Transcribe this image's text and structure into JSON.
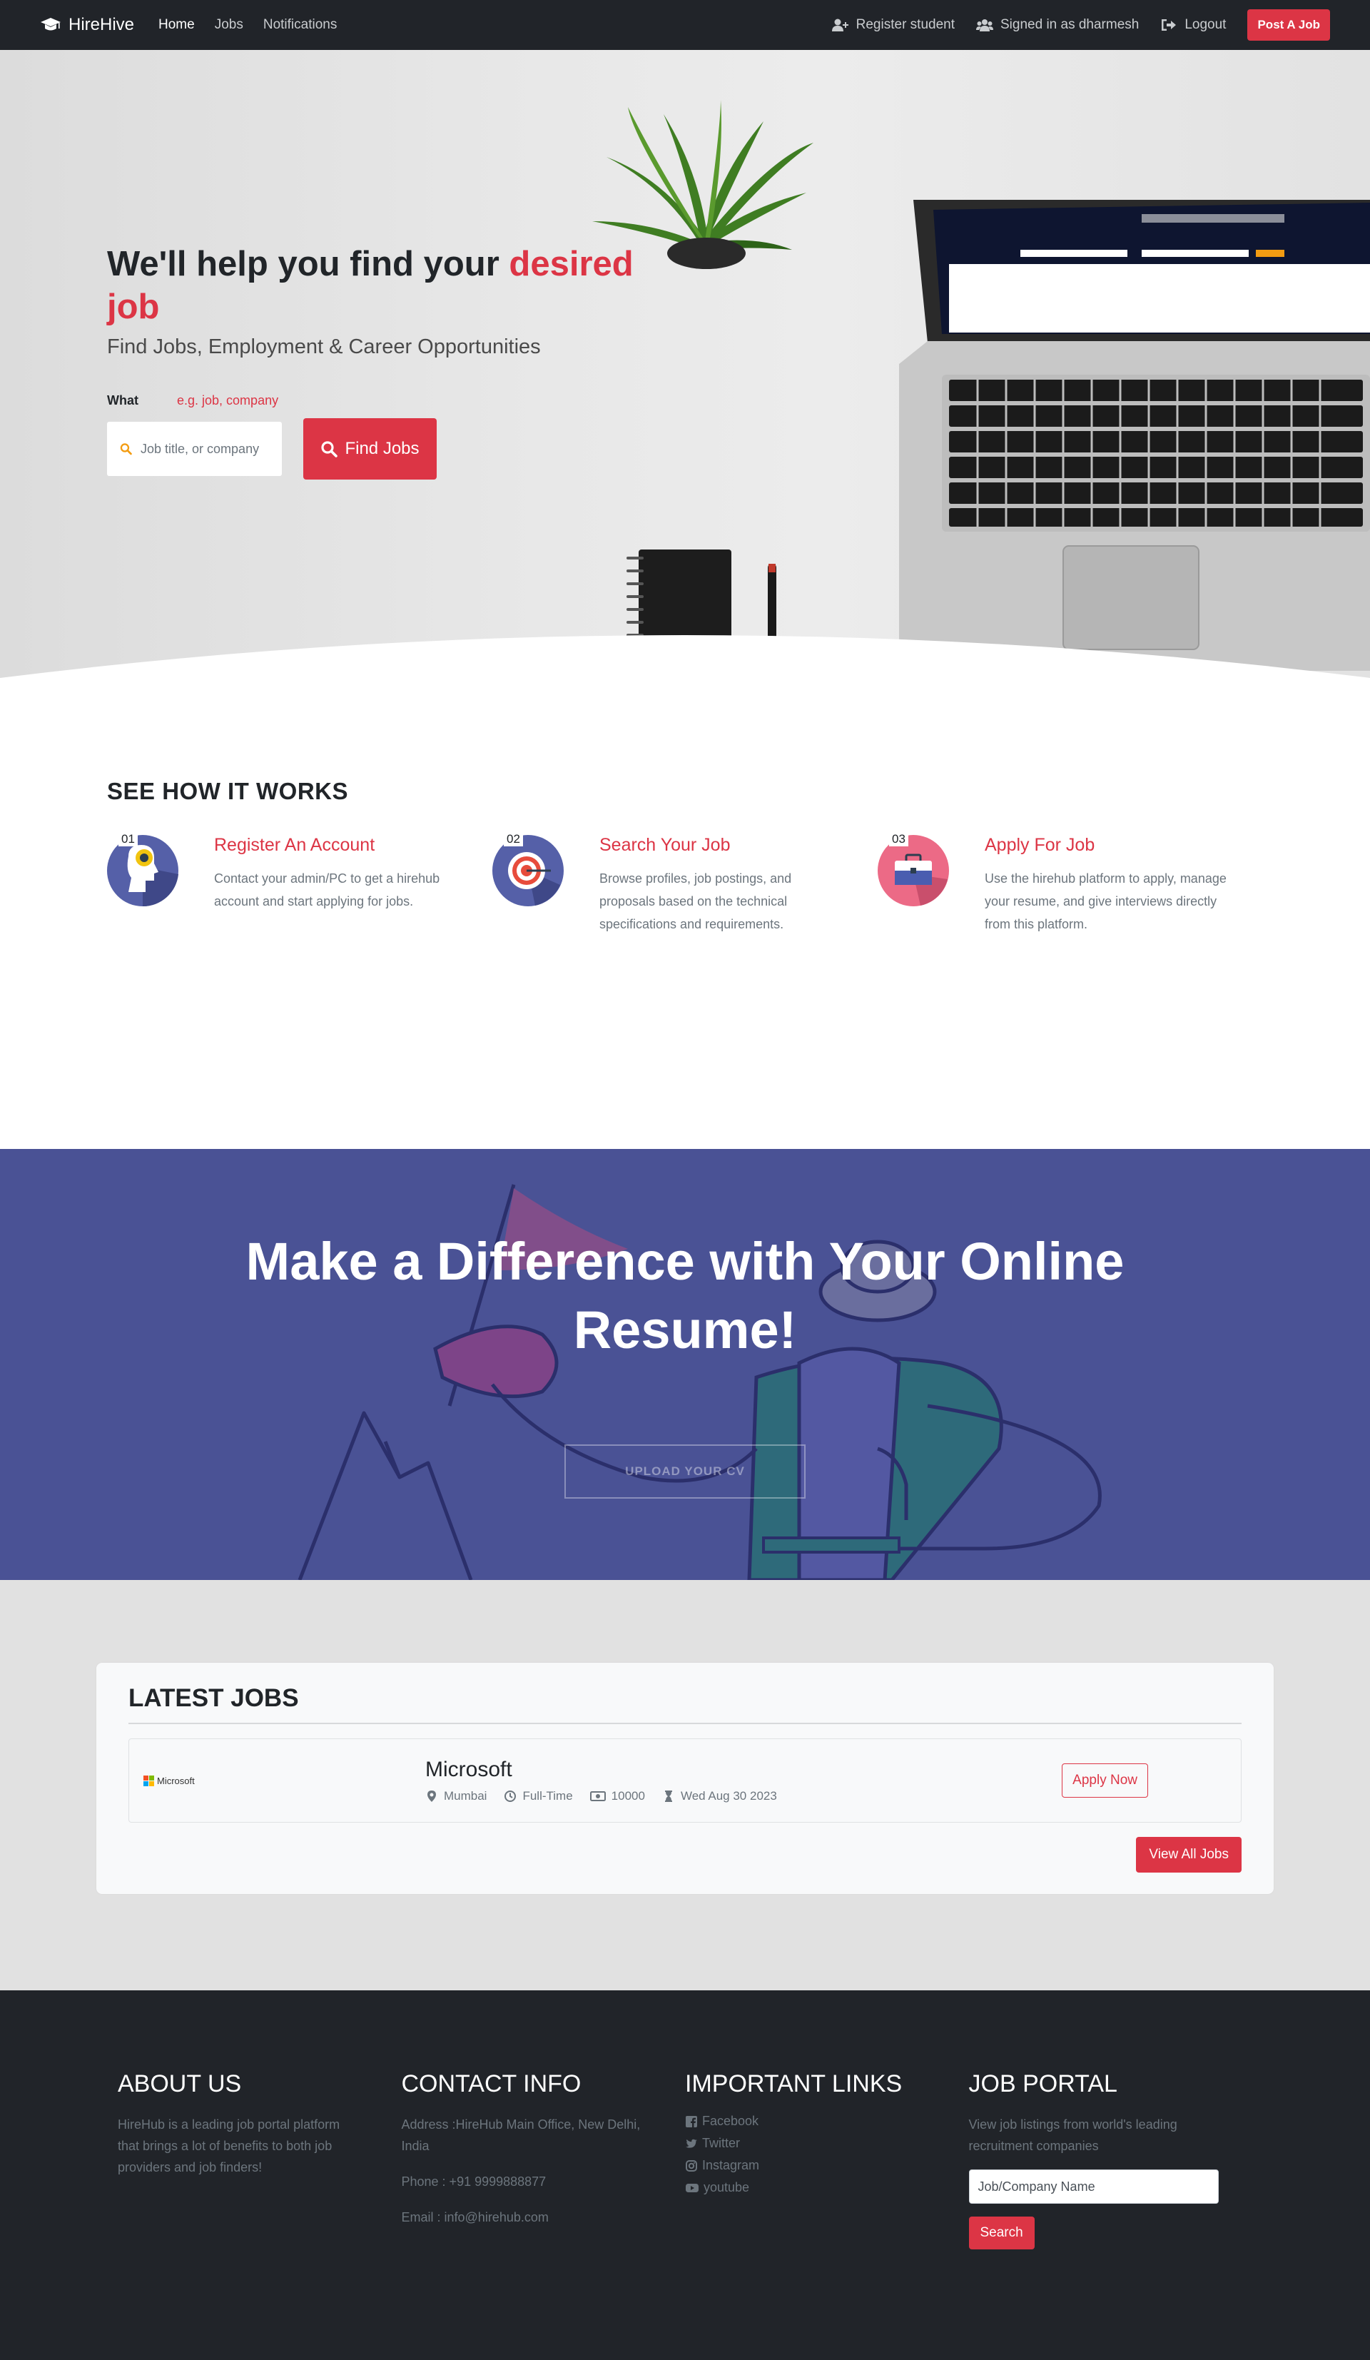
{
  "nav": {
    "brand": "HireHive",
    "links": [
      "Home",
      "Jobs",
      "Notifications"
    ],
    "register": "Register student",
    "signed_in": "Signed in as dharmesh",
    "logout": "Logout",
    "post_job": "Post A Job"
  },
  "hero": {
    "title_part1": "We'll help you find your ",
    "title_accent1": "desired",
    "title_accent2": "job",
    "subtitle": "Find Jobs, Employment & Career Opportunities",
    "what_label": "What",
    "what_hint": "e.g. job, company",
    "search_placeholder": "Job title, or company",
    "find_button": "Find Jobs"
  },
  "how": {
    "title": "SEE HOW IT WORKS",
    "steps": [
      {
        "num": "01",
        "title": "Register An Account",
        "desc": "Contact your admin/PC to get a hirehub account and start applying for jobs."
      },
      {
        "num": "02",
        "title": "Search Your Job",
        "desc": "Browse profiles, job postings, and proposals based on the technical specifications and requirements."
      },
      {
        "num": "03",
        "title": "Apply For Job",
        "desc": "Use the hirehub platform to apply, manage your resume, and give interviews directly from this platform."
      }
    ]
  },
  "cta": {
    "title_line1": "Make a Difference with Your Online",
    "title_line2": "Resume!",
    "button": "UPLOAD YOUR CV"
  },
  "jobs": {
    "title": "LATEST JOBS",
    "items": [
      {
        "logo_text": "Microsoft",
        "company": "Microsoft",
        "location": "Mumbai",
        "type": "Full-Time",
        "salary": "10000",
        "date": "Wed Aug 30 2023",
        "apply": "Apply Now"
      }
    ],
    "view_all": "View All Jobs"
  },
  "footer": {
    "about_title": "ABOUT US",
    "about_text": "HireHub is a leading job portal platform that brings a lot of benefits to both job providers and job finders!",
    "contact_title": "CONTACT INFO",
    "contact_address": "Address :HireHub Main Office, New Delhi, India",
    "contact_phone": "Phone : +91 9999888877",
    "contact_email": "Email : info@hirehub.com",
    "links_title": "IMPORTANT LINKS",
    "links": [
      "Facebook",
      "Twitter",
      "Instagram",
      "youtube"
    ],
    "portal_title": "JOB PORTAL",
    "portal_text": "View job listings from world's leading recruitment companies",
    "portal_placeholder": "Job/Company Name",
    "portal_button": "Search"
  },
  "colors": {
    "accent": "#dc3545",
    "nav_bg": "#212429",
    "cta_bg": "#4a5295"
  }
}
